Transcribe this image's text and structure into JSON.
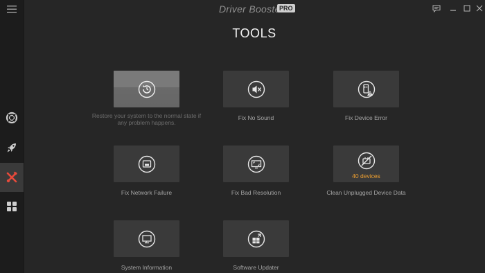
{
  "app": {
    "title": "Driver Booster 7",
    "edition_badge": "PRO"
  },
  "page_title": "TOOLS",
  "sidebar": {
    "items": [
      {
        "name": "scan",
        "icon": "lifebuoy-icon",
        "active": false
      },
      {
        "name": "boost",
        "icon": "rocket-icon",
        "active": false
      },
      {
        "name": "tools",
        "icon": "tools-icon",
        "active": true
      },
      {
        "name": "action-center",
        "icon": "grid-icon",
        "active": false
      }
    ]
  },
  "tools": [
    {
      "label": "Restore your system to the normal state if any problem happens.",
      "icon": "restore-icon"
    },
    {
      "label": "Fix No Sound",
      "icon": "mute-speaker-icon"
    },
    {
      "label": "Fix Device Error",
      "icon": "device-error-icon"
    },
    {
      "label": "Fix Network Failure",
      "icon": "network-icon"
    },
    {
      "label": "Fix Bad Resolution",
      "icon": "resolution-icon"
    },
    {
      "label": "Clean Unplugged Device Data",
      "icon": "unplugged-device-icon",
      "badge": "40 devices"
    },
    {
      "label": "System Information",
      "icon": "system-info-icon"
    },
    {
      "label": "Software Updater",
      "icon": "software-updater-icon"
    }
  ],
  "colors": {
    "background": "#262626",
    "sidebar": "#1c1c1c",
    "tile": "#3a3a3a",
    "active_tool": "#e64a3b",
    "badge": "#f0a030"
  }
}
